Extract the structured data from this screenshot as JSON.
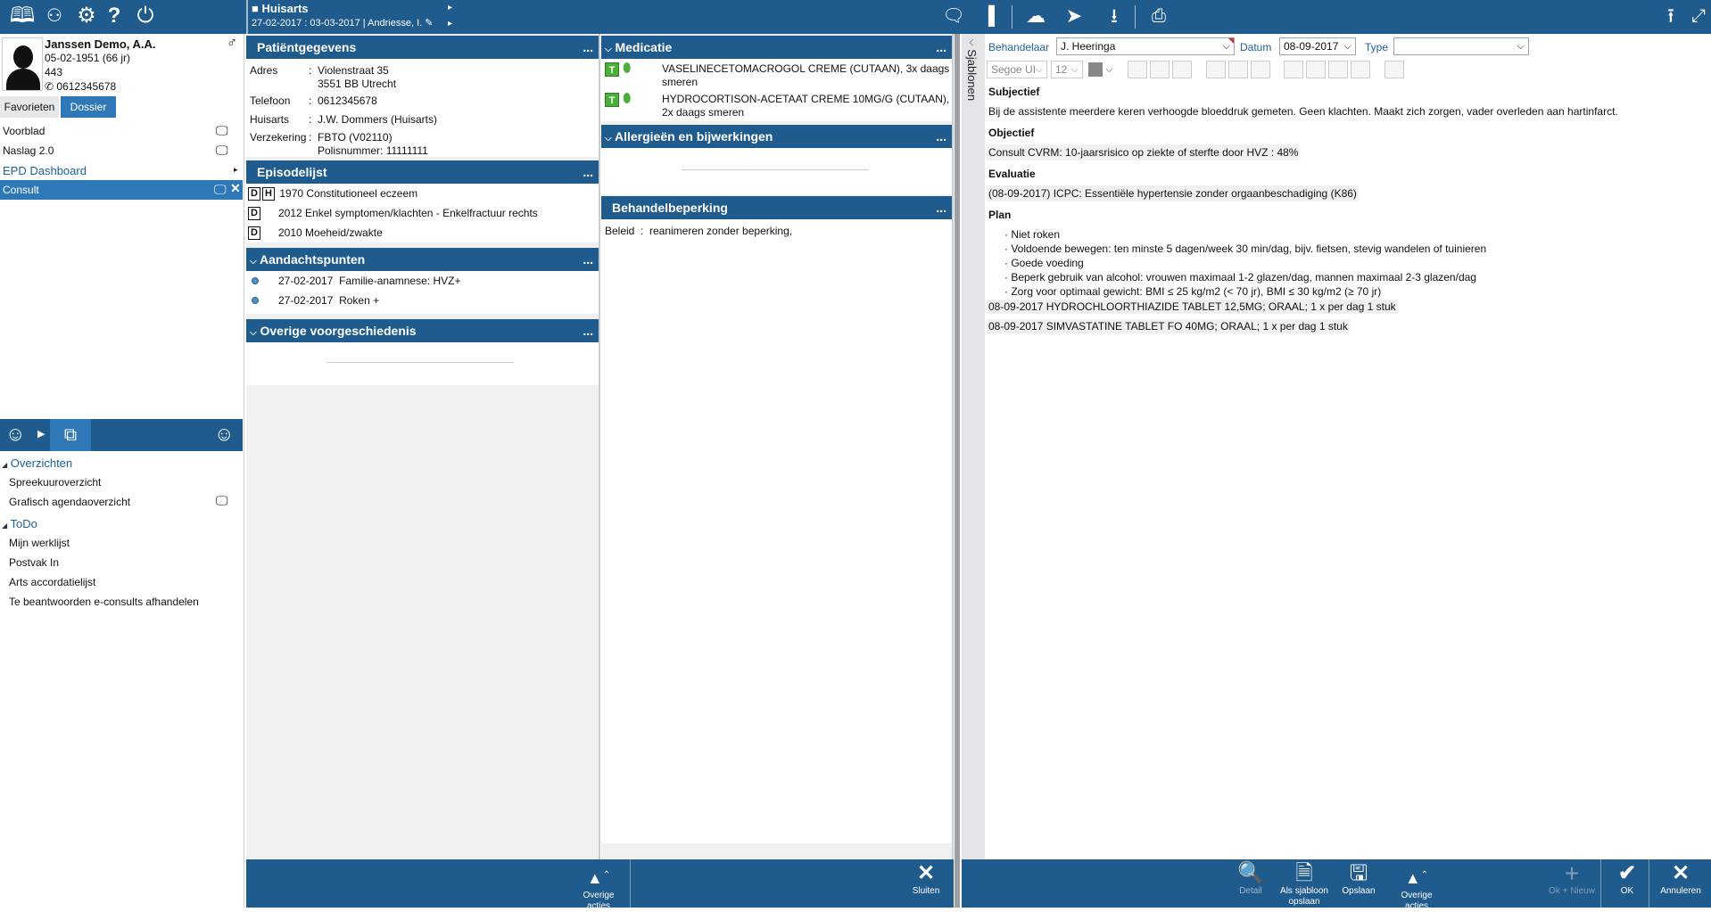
{
  "topbar": {
    "context_title": "Huisarts",
    "context_sub": "27-02-2017 : 03-03-2017 | Andriesse, I.",
    "left_icons": [
      "book-icon",
      "binoculars-icon",
      "gears-icon",
      "help-icon",
      "power-icon"
    ],
    "right_icons": [
      "chat-icon",
      "clipboard-icon",
      "cloud-add-icon",
      "forward-icon",
      "download-icon",
      "printer-icon"
    ],
    "corner_icons": [
      "undock-icon",
      "maximize-icon"
    ]
  },
  "patient": {
    "name": "Janssen Demo, A.A.",
    "dob": "05-02-1951 (66 jr)",
    "id": "443",
    "phone": "0612345678",
    "gender_icon": "male-icon"
  },
  "tabs": {
    "favorieten": "Favorieten",
    "dossier": "Dossier"
  },
  "nav": {
    "items": [
      {
        "label": "Voorblad"
      },
      {
        "label": "Naslag 2.0"
      },
      {
        "label": "EPD Dashboard"
      },
      {
        "label": "Consult"
      }
    ]
  },
  "overzichten": {
    "title": "Overzichten",
    "items": [
      "Spreekuuroverzicht",
      "Grafisch agendaoverzicht"
    ]
  },
  "todo": {
    "title": "ToDo",
    "items": [
      "Mijn werklijst",
      "Postvak In",
      "Arts accordatielijst",
      "Te beantwoorden e-consults afhandelen"
    ]
  },
  "patientgegevens": {
    "title": "Patiëntgegevens",
    "rows": [
      {
        "label": "Adres",
        "value": "Violenstraat 35",
        "value2": "3551 BB  Utrecht"
      },
      {
        "label": "Telefoon",
        "value": "0612345678"
      },
      {
        "label": "Huisarts",
        "value": "J.W. Dommers (Huisarts)"
      },
      {
        "label": "Verzekering",
        "value": "FBTO (V02110)",
        "value2": "Polisnummer: 11111111"
      }
    ]
  },
  "episodelijst": {
    "title": "Episodelijst",
    "items": [
      {
        "badges": [
          "D",
          "H"
        ],
        "text": "1970 Constitutioneel eczeem"
      },
      {
        "badges": [
          "D"
        ],
        "text": "2012 Enkel symptomen/klachten  - Enkelfractuur rechts"
      },
      {
        "badges": [
          "D"
        ],
        "text": "2010 Moeheid/zwakte"
      }
    ]
  },
  "aandachtspunten": {
    "title": "Aandachtspunten",
    "items": [
      {
        "date": "27-02-2017",
        "text": "Familie-anamnese: HVZ+"
      },
      {
        "date": "27-02-2017",
        "text": "Roken +"
      }
    ]
  },
  "voorgeschiedenis": {
    "title": "Overige voorgeschiedenis"
  },
  "medicatie": {
    "title": "Medicatie",
    "items": [
      {
        "badge": "T",
        "line1": "VASELINECETOMACROGOL CREME (CUTAAN), 3x daags",
        "line2": "smeren"
      },
      {
        "badge": "T",
        "line1": "HYDROCORTISON-ACETAAT CREME 10MG/G (CUTAAN),",
        "line2": "2x daags smeren"
      }
    ]
  },
  "allergieen": {
    "title": "Allergieën en bijwerkingen"
  },
  "behandelbeperking": {
    "title": "Behandelbeperking",
    "label": "Beleid",
    "value": "reanimeren zonder beperking,"
  },
  "sjablonen": "Sjablonen",
  "consult": {
    "behandelaar_label": "Behandelaar",
    "behandelaar_value": "J. Heeringa",
    "datum_label": "Datum",
    "datum_value": "08-09-2017",
    "type_label": "Type",
    "type_value": "",
    "font_value": "Segoe UI",
    "size_value": "12",
    "subjectief_title": "Subjectief",
    "subjectief_text": "Bij de assistente meerdere keren verhoogde bloeddruk gemeten. Geen klachten. Maakt zich zorgen, vader overleden aan hartinfarct.",
    "objectief_title": "Objectief",
    "objectief_text": "Consult CVRM: 10-jaarsrisico op ziekte of sterfte door HVZ : 48%",
    "evaluatie_title": "Evaluatie",
    "evaluatie_text": "(08-09-2017) ICPC: Essentiële hypertensie zonder orgaanbeschadiging (K86)",
    "plan_title": "Plan",
    "plan_items": [
      "· Niet roken",
      "· Voldoende bewegen: ten minste 5 dagen/week 30 min/dag, bijv. fietsen, stevig wandelen of tuinieren",
      "· Goede voeding",
      "· Beperk gebruik van alcohol: vrouwen maximaal 1-2 glazen/dag, mannen maximaal 2-3 glazen/dag",
      "· Zorg voor optimaal gewicht: BMI ≤ 25 kg/m2 (< 70 jr), BMI ≤ 30 kg/m2 (≥ 70 jr)"
    ],
    "prescriptions": [
      "08-09-2017 HYDROCHLOORTHIAZIDE TABLET 12,5MG; ORAAL; 1 x per dag 1 stuk",
      "08-09-2017 SIMVASTATINE TABLET FO 40MG; ORAAL; 1 x per dag 1 stuk"
    ]
  },
  "footer": {
    "overige_acties": "Overige acties",
    "sluiten": "Sluiten",
    "detail": "Detail",
    "als_sjabloon": "Als sjabloon opslaan",
    "opslaan": "Opslaan",
    "ok_nieuw": "Ok + Nieuw",
    "ok": "OK",
    "annuleren": "Annuleren"
  },
  "colors": {
    "brand": "#1f5b8d",
    "selected": "#2f78b7"
  }
}
